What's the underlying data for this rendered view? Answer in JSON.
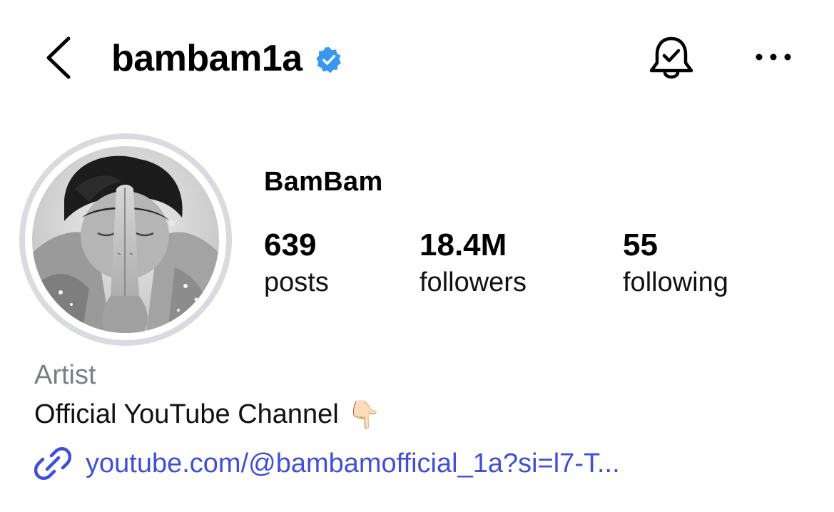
{
  "header": {
    "username": "bambam1a",
    "verified": true,
    "back_icon": "chevron-left-icon",
    "bell_icon": "bell-check-icon",
    "more_icon": "more-horizontal-icon"
  },
  "profile": {
    "display_name": "BamBam",
    "avatar": "profile-photo",
    "stats": [
      {
        "value": "639",
        "label": "posts"
      },
      {
        "value": "18.4M",
        "label": "followers"
      },
      {
        "value": "55",
        "label": "following"
      }
    ],
    "category": "Artist",
    "bio": "Official YouTube Channel",
    "bio_emoji": "👇🏻",
    "link": "youtube.com/@bambamofficial_1a?si=l7-T..."
  },
  "colors": {
    "verified_blue": "#3897f0",
    "link_blue": "#3f4fd8",
    "category_gray": "#7a7e86",
    "ring_gray": "#d9dbe0"
  }
}
